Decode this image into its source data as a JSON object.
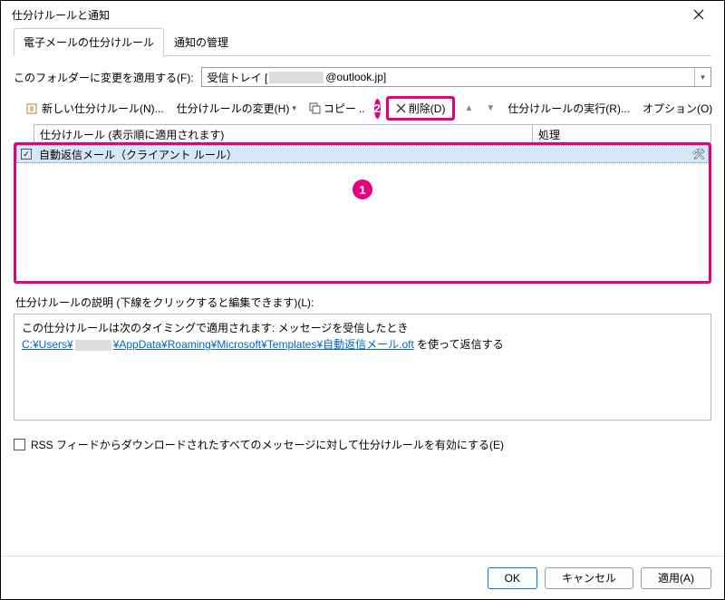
{
  "title": "仕分けルールと通知",
  "tabs": {
    "email": "電子メールの仕分けルール",
    "notify": "通知の管理"
  },
  "folder": {
    "label": "このフォルダーに変更を適用する(F):",
    "value_prefix": "受信トレイ [",
    "value_suffix": "@outlook.jp]"
  },
  "toolbar": {
    "new_rule": "新しい仕分けルール(N)...",
    "change_rule": "仕分けルールの変更(H)",
    "copy": "コピー",
    "delete": "削除(D)",
    "run": "仕分けルールの実行(R)...",
    "options": "オプション(O)"
  },
  "list_header": {
    "col1": "仕分けルール (表示順に適用されます)",
    "col2": "処理"
  },
  "rules": [
    {
      "name": "自動返信メール（クライアント ルール）",
      "checked": true
    }
  ],
  "desc_label": "仕分けルールの説明 (下線をクリックすると編集できます)(L):",
  "desc_line1": "この仕分けルールは次のタイミングで適用されます: メッセージを受信したとき",
  "desc_link_prefix": "C:¥Users¥",
  "desc_link_suffix": "¥AppData¥Roaming¥Microsoft¥Templates¥自動返信メール.oft",
  "desc_after": " を使って返信する",
  "rss": "RSS フィードからダウンロードされたすべてのメッセージに対して仕分けルールを有効にする(E)",
  "footer": {
    "ok": "OK",
    "cancel": "キャンセル",
    "apply": "適用(A)"
  },
  "badges": {
    "one": "1",
    "two": "2"
  }
}
